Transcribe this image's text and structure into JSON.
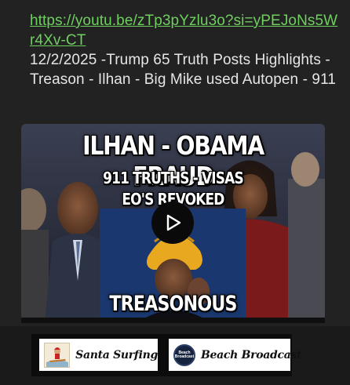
{
  "post": {
    "link_text": "https://youtu.be/zTp3pYzlu3o?si=yPEJoNs5Wr4Xv-CT",
    "body_text": "12/2/2025 -Trump 65 Truth Posts Highlights - Treason - Ilhan - Big Mike used Autopen - 911"
  },
  "video": {
    "headline": "ILHAN - OBAMA FRAUD",
    "subline_1": "911 TRUTHS - VISAS",
    "subline_2": "EO'S REVOKED",
    "bottom_caption": "TREASONOUS",
    "play_icon": "play-icon"
  },
  "ads": [
    {
      "label": "Santa Surfing",
      "logo_icon": "santa-surfing-logo"
    },
    {
      "label": "Beach Broadcast",
      "logo_text": "Beach Broadcast",
      "logo_icon": "beach-broadcast-logo"
    }
  ],
  "colors": {
    "link": "#6fcf5f",
    "text": "#e6e6e6",
    "background": "#222222",
    "turban": "#e8a81f"
  }
}
